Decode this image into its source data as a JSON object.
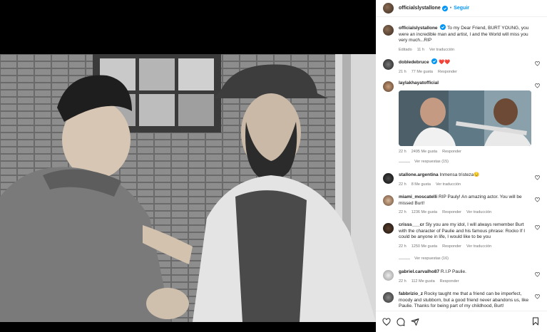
{
  "header": {
    "username": "officialslystallone",
    "separator": "•",
    "follow_label": "Seguir"
  },
  "caption": {
    "username": "officialslystallone",
    "text": "To my Dear Friend, BURT YOUNG, you were an incredible man and artist, I and the World will miss you very much...RIP",
    "edited": "Editado",
    "time": "11 h",
    "translate": "Ver traducción"
  },
  "comments": [
    {
      "username": "dobledebruce",
      "text": "❤️❤️",
      "time": "21 h",
      "likes": "77 Me gusta",
      "reply": "Responder",
      "verified": true
    },
    {
      "username": "laylakhayatofficial",
      "text": "",
      "time": "22 h",
      "likes": "2495 Me gusta",
      "reply": "Responder",
      "replies": "Ver respuestas (15)"
    },
    {
      "username": "stallone.argentina",
      "text": "Inmensa tristeza😔",
      "time": "22 h",
      "likes": "8 Me gusta",
      "translate": "Ver traducción"
    },
    {
      "username": "miami_moscatelli",
      "text": "RIP Pauly! An amazing actor. You will be missed Burt!",
      "time": "22 h",
      "likes": "1236 Me gusta",
      "reply": "Responder",
      "translate": "Ver traducción"
    },
    {
      "username": "crisss___cr",
      "text": "Sly you are my idol, I will always remember Burt with the character of Paulie and his famous phrase: Rocko If I could be anyone in life, I would like to be you",
      "time": "22 h",
      "likes": "1250 Me gusta",
      "reply": "Responder",
      "translate": "Ver traducción",
      "replies": "Ver respuestas (16)"
    },
    {
      "username": "gabriel.carvalho87",
      "text": "R.I.P Paulie.",
      "time": "22 h",
      "likes": "112 Me gusta",
      "reply": "Responder"
    },
    {
      "username": "fabbrizio_z",
      "text": "Rocky taught me that a friend can be imperfect, moody and stubborn, but a good friend never abandons us, like Paulie. Thanks for being part of my childhood, Burt!"
    }
  ],
  "icons": {
    "like": "heart-icon",
    "comment": "comment-icon",
    "share": "share-icon",
    "save": "bookmark-icon",
    "verified": "verified-badge-icon"
  },
  "colors": {
    "link": "#0095f6",
    "muted": "#737373",
    "text": "#262626",
    "heart_red": "#ed4956"
  }
}
